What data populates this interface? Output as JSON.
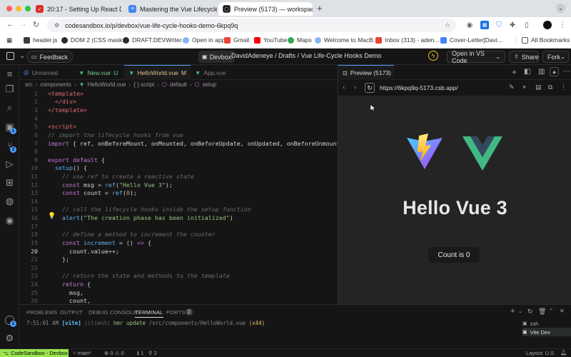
{
  "browser": {
    "tabs": [
      {
        "title": "20:17 - Setting Up React Dev",
        "icon": "red-check-icon",
        "color": "#d93025"
      },
      {
        "title": "Mastering the Vue Lifecycle H",
        "icon": "docs-icon",
        "color": "#4285f4"
      },
      {
        "title": "Preview (5173) — workspace",
        "icon": "codesandbox-icon",
        "color": "#111111"
      }
    ],
    "url": "codesandbox.io/p/devbox/vue-life-cycle-hooks-demo-6kpq9q",
    "bookmarks": [
      "header.js",
      "DOM 2 (CSS mask...",
      "DRAFT.DEVWriter...",
      "Open in app",
      "Gmail",
      "YouTube",
      "Maps",
      "Welcome to MacB...",
      "Inbox (313) - aden...",
      "Cover-Letter[Davi..."
    ],
    "all_bookmarks": "All Bookmarks"
  },
  "appbar": {
    "feedback": "Feedback",
    "devbox": "Devbox",
    "breadcrumb": "DavidAdeneye / Drafts / Vue Life-Cycle Hooks Demo",
    "open_in": "Open in VS Code",
    "share": "Share",
    "fork": "Fork"
  },
  "activity_badges": {
    "run": "1",
    "source": "2"
  },
  "editor": {
    "tabs": [
      {
        "label": "Unnamed",
        "suffix": "",
        "color": "#7f7f7f"
      },
      {
        "label": "New.vue",
        "suffix": "U",
        "color": "#73c991"
      },
      {
        "label": "HelloWorld.vue",
        "suffix": "M",
        "color": "#e2c08d"
      },
      {
        "label": "App.vue",
        "suffix": "",
        "color": "#7f7f7f"
      }
    ],
    "breadcrumb": [
      "src",
      "components",
      "HelloWorld.vue",
      "{ } script",
      "default",
      "setup"
    ],
    "current_line": "20",
    "lines": [
      {
        "n": "1",
        "tokens": [
          [
            "tag",
            "<template>"
          ]
        ]
      },
      {
        "n": "2",
        "tokens": [
          [
            "tag",
            "  </div>"
          ]
        ]
      },
      {
        "n": "3",
        "tokens": [
          [
            "tag",
            "</template>"
          ]
        ]
      },
      {
        "n": "4",
        "tokens": []
      },
      {
        "n": "5",
        "tokens": [
          [
            "tag",
            "<script>"
          ]
        ]
      },
      {
        "n": "6",
        "tokens": [
          [
            "cm",
            "// import the lifecycle hooks from vue"
          ]
        ]
      },
      {
        "n": "7",
        "tokens": [
          [
            "key",
            "import"
          ],
          [
            "pl",
            " { ref, onBeforeMount, onMounted, onBeforeUpdate, onUpdated, onBeforeUnmount, on"
          ]
        ]
      },
      {
        "n": "8",
        "tokens": []
      },
      {
        "n": "9",
        "tokens": [
          [
            "key",
            "export default"
          ],
          [
            "pl",
            " {"
          ]
        ]
      },
      {
        "n": "10",
        "tokens": [
          [
            "pl",
            "  "
          ],
          [
            "fn",
            "setup"
          ],
          [
            "pl",
            "() {"
          ]
        ]
      },
      {
        "n": "11",
        "tokens": [
          [
            "cm",
            "    // use ref to create a reactive state"
          ]
        ]
      },
      {
        "n": "12",
        "tokens": [
          [
            "pl",
            "    "
          ],
          [
            "key",
            "const"
          ],
          [
            "pl",
            " msg = "
          ],
          [
            "fn",
            "ref"
          ],
          [
            "pl",
            "("
          ],
          [
            "str",
            "\"Hello Vue 3\""
          ],
          [
            "pl",
            ");"
          ]
        ]
      },
      {
        "n": "13",
        "tokens": [
          [
            "pl",
            "    "
          ],
          [
            "key",
            "const"
          ],
          [
            "pl",
            " count = "
          ],
          [
            "fn",
            "ref"
          ],
          [
            "pl",
            "("
          ],
          [
            "num",
            "0"
          ],
          [
            "pl",
            ");"
          ]
        ]
      },
      {
        "n": "14",
        "tokens": []
      },
      {
        "n": "15",
        "tokens": [
          [
            "cm",
            "    // call the lifecycle hooks inside the setup function"
          ]
        ]
      },
      {
        "n": "16",
        "tokens": [
          [
            "pl",
            "    "
          ],
          [
            "fn",
            "alert"
          ],
          [
            "pl",
            "("
          ],
          [
            "str",
            "\"The creation phase has been initialized\""
          ],
          [
            "pl",
            ")"
          ]
        ]
      },
      {
        "n": "17",
        "tokens": []
      },
      {
        "n": "18",
        "tokens": [
          [
            "cm",
            "    // define a method to increment the counter"
          ]
        ]
      },
      {
        "n": "19",
        "tokens": [
          [
            "pl",
            "    "
          ],
          [
            "key",
            "const"
          ],
          [
            "pl",
            " "
          ],
          [
            "fn",
            "increment"
          ],
          [
            "pl",
            " = () "
          ],
          [
            "key",
            "=>"
          ],
          [
            "pl",
            " {"
          ]
        ]
      },
      {
        "n": "20",
        "tokens": [
          [
            "pl",
            "      count.value++;"
          ]
        ]
      },
      {
        "n": "21",
        "tokens": [
          [
            "pl",
            "    };"
          ]
        ]
      },
      {
        "n": "22",
        "tokens": []
      },
      {
        "n": "23",
        "tokens": [
          [
            "cm",
            "    // return the state and methods to the template"
          ]
        ]
      },
      {
        "n": "24",
        "tokens": [
          [
            "pl",
            "    "
          ],
          [
            "key",
            "return"
          ],
          [
            "pl",
            " {"
          ]
        ]
      },
      {
        "n": "25",
        "tokens": [
          [
            "pl",
            "      msg,"
          ]
        ]
      },
      {
        "n": "26",
        "tokens": [
          [
            "pl",
            "      count,"
          ]
        ]
      }
    ]
  },
  "preview": {
    "tab_title": "Preview (5173)",
    "url": "https://6kpq9q-5173.csb.app/",
    "heading": "Hello Vue 3",
    "count_button": "Count is 0"
  },
  "panel": {
    "tabs": [
      "PROBLEMS",
      "OUTPUT",
      "DEBUG CONSOLE",
      "TERMINAL",
      "PORTS"
    ],
    "ports_count": "2",
    "log_time": "7:51:01 AM",
    "log_tag": "[vite]",
    "log_client": "(client)",
    "log_msg": "hmr update",
    "log_path": "/src/components/HelloWorld.vue",
    "log_count": "(x44)",
    "terminals": [
      "zsh",
      "Vite Dev"
    ]
  },
  "status": {
    "brand": "CodeSandbox - Devbox",
    "branch": "main*",
    "problems": "0",
    "warnings": "0",
    "info_a": "1",
    "info_b": "2",
    "layout": "Layout: U.S."
  },
  "colors": {
    "accent": "#4b9bff",
    "vue_green": "#42b883",
    "vite_purple": "#a855f7"
  }
}
